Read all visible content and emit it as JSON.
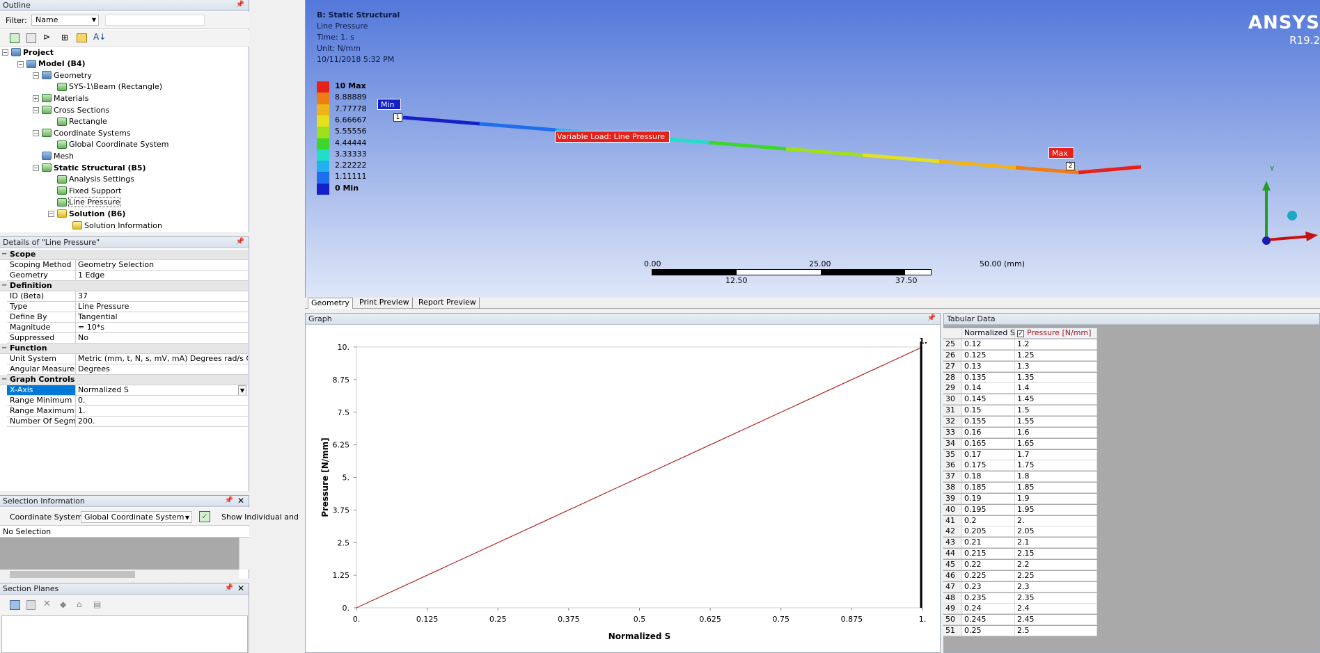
{
  "outline": {
    "title": "Outline",
    "filter_label": "Filter:",
    "filter_value": "Name",
    "tree": [
      {
        "label": "Project",
        "bold": true,
        "indent": 0,
        "icon": "project-icon"
      },
      {
        "label": "Model (B4)",
        "bold": true,
        "indent": 1,
        "icon": "model-icon"
      },
      {
        "label": "Geometry",
        "indent": 2,
        "icon": "geometry-icon"
      },
      {
        "label": "SYS-1\\Beam (Rectangle)",
        "indent": 3,
        "icon": "beam-icon"
      },
      {
        "label": "Materials",
        "indent": 2,
        "icon": "materials-icon"
      },
      {
        "label": "Cross Sections",
        "indent": 2,
        "icon": "cross-sections-icon"
      },
      {
        "label": "Rectangle",
        "indent": 3,
        "icon": "rectangle-icon"
      },
      {
        "label": "Coordinate Systems",
        "indent": 2,
        "icon": "coordinate-systems-icon"
      },
      {
        "label": "Global Coordinate System",
        "indent": 3,
        "icon": "axis-icon"
      },
      {
        "label": "Mesh",
        "indent": 2,
        "icon": "mesh-icon"
      },
      {
        "label": "Static Structural (B5)",
        "bold": true,
        "indent": 2,
        "icon": "static-structural-icon"
      },
      {
        "label": "Analysis Settings",
        "indent": 3,
        "icon": "analysis-settings-icon"
      },
      {
        "label": "Fixed Support",
        "indent": 3,
        "icon": "fixed-support-icon"
      },
      {
        "label": "Line Pressure",
        "indent": 3,
        "icon": "line-pressure-icon",
        "selected": true
      },
      {
        "label": "Solution (B6)",
        "bold": true,
        "indent": 3,
        "icon": "solution-icon"
      },
      {
        "label": "Solution Information",
        "indent": 4,
        "icon": "solution-information-icon"
      }
    ]
  },
  "details": {
    "title": "Details of \"Line Pressure\"",
    "groups": [
      {
        "name": "Scope",
        "rows": [
          [
            "Scoping Method",
            "Geometry Selection"
          ],
          [
            "Geometry",
            "1 Edge"
          ]
        ]
      },
      {
        "name": "Definition",
        "rows": [
          [
            "ID (Beta)",
            "37"
          ],
          [
            "Type",
            "Line Pressure"
          ],
          [
            "Define By",
            "Tangential"
          ],
          [
            "Magnitude",
            "= 10*s"
          ],
          [
            "Suppressed",
            "No"
          ]
        ]
      },
      {
        "name": "Function",
        "rows": [
          [
            "Unit System",
            "Metric (mm, t, N, s, mV, mA)  Degrees  rad/s  Celsius"
          ],
          [
            "Angular Measure",
            "Degrees"
          ]
        ]
      },
      {
        "name": "Graph Controls",
        "rows": [
          [
            "X-Axis",
            "Normalized S"
          ],
          [
            "Range Minimum",
            "0."
          ],
          [
            "Range Maximum",
            "1."
          ],
          [
            "Number Of Segments",
            "200."
          ]
        ]
      }
    ]
  },
  "selection": {
    "title": "Selection Information",
    "coord_label": "Coordinate System:",
    "coord_value": "Global Coordinate System",
    "show_label": "Show Individual and",
    "status": "No Selection"
  },
  "section_planes": {
    "title": "Section Planes"
  },
  "viewport": {
    "header": [
      "B: Static Structural",
      "Line Pressure",
      "Time: 1. s",
      "Unit: N/mm",
      "10/11/2018 5:32 PM"
    ],
    "legend": [
      {
        "label": "10 Max",
        "color": "#e8201a",
        "bold": true
      },
      {
        "label": "8.88889",
        "color": "#f27c14"
      },
      {
        "label": "7.77778",
        "color": "#f0b418"
      },
      {
        "label": "6.66667",
        "color": "#e2e11c"
      },
      {
        "label": "5.55556",
        "color": "#9fe01a"
      },
      {
        "label": "4.44444",
        "color": "#3ed62a"
      },
      {
        "label": "3.33333",
        "color": "#22dec6"
      },
      {
        "label": "2.22222",
        "color": "#1fb2ee"
      },
      {
        "label": "1.11111",
        "color": "#1f6ef0"
      },
      {
        "label": "0 Min",
        "color": "#1420c8",
        "bold": true
      }
    ],
    "logo": "ANSYS",
    "version": "R19.2",
    "min_tag": "Min",
    "max_tag": "Max",
    "load_tag": "Variable Load: Line Pressure",
    "node1": "1",
    "node2": "2",
    "axis_y": "Y",
    "scale_top": [
      "0.00",
      "25.00",
      "50.00 (mm)"
    ],
    "scale_bottom": [
      "12.50",
      "37.50"
    ],
    "tabs": [
      "Geometry",
      "Print Preview",
      "Report Preview"
    ]
  },
  "graph": {
    "title": "Graph",
    "top_label": "1."
  },
  "chart_data": {
    "type": "line",
    "xlabel": "Normalized S",
    "ylabel": "Pressure [N/mm]",
    "xlim": [
      0,
      1
    ],
    "ylim": [
      0,
      10
    ],
    "xticks": [
      "0.",
      "0.125",
      "0.25",
      "0.375",
      "0.5",
      "0.625",
      "0.75",
      "0.875",
      "1."
    ],
    "yticks": [
      "0.",
      "1.25",
      "2.5",
      "3.75",
      "5.",
      "6.25",
      "7.5",
      "8.75",
      "10."
    ],
    "series": [
      {
        "values": [
          [
            0,
            0
          ],
          [
            1,
            10
          ]
        ],
        "color": "#b22222"
      }
    ],
    "grid": false
  },
  "tabular": {
    "title": "Tabular Data",
    "headers": [
      "Normalized S",
      "Pressure [N/mm]"
    ],
    "rows": [
      [
        "25",
        "0.12",
        "1.2"
      ],
      [
        "26",
        "0.125",
        "1.25"
      ],
      [
        "27",
        "0.13",
        "1.3"
      ],
      [
        "28",
        "0.135",
        "1.35"
      ],
      [
        "29",
        "0.14",
        "1.4"
      ],
      [
        "30",
        "0.145",
        "1.45"
      ],
      [
        "31",
        "0.15",
        "1.5"
      ],
      [
        "32",
        "0.155",
        "1.55"
      ],
      [
        "33",
        "0.16",
        "1.6"
      ],
      [
        "34",
        "0.165",
        "1.65"
      ],
      [
        "35",
        "0.17",
        "1.7"
      ],
      [
        "36",
        "0.175",
        "1.75"
      ],
      [
        "37",
        "0.18",
        "1.8"
      ],
      [
        "38",
        "0.185",
        "1.85"
      ],
      [
        "39",
        "0.19",
        "1.9"
      ],
      [
        "40",
        "0.195",
        "1.95"
      ],
      [
        "41",
        "0.2",
        "2."
      ],
      [
        "42",
        "0.205",
        "2.05"
      ],
      [
        "43",
        "0.21",
        "2.1"
      ],
      [
        "44",
        "0.215",
        "2.15"
      ],
      [
        "45",
        "0.22",
        "2.2"
      ],
      [
        "46",
        "0.225",
        "2.25"
      ],
      [
        "47",
        "0.23",
        "2.3"
      ],
      [
        "48",
        "0.235",
        "2.35"
      ],
      [
        "49",
        "0.24",
        "2.4"
      ],
      [
        "50",
        "0.245",
        "2.45"
      ],
      [
        "51",
        "0.25",
        "2.5"
      ]
    ]
  }
}
